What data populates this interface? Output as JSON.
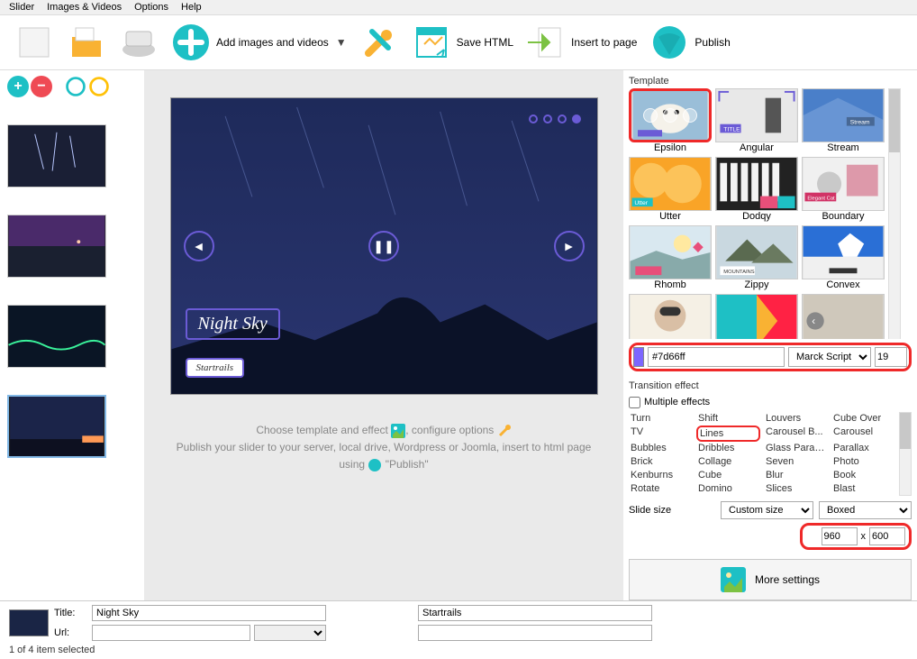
{
  "menu": {
    "slider": "Slider",
    "images": "Images & Videos",
    "options": "Options",
    "help": "Help"
  },
  "toolbar": {
    "addimages": "Add images and videos",
    "savehtml": "Save HTML",
    "insert": "Insert to page",
    "publish": "Publish"
  },
  "preview": {
    "title": "Night Sky",
    "subtitle": "Startrails"
  },
  "help": {
    "line1a": "Choose template and effect ",
    "line1b": ", configure options ",
    "line2": "Publish your slider to your server, local drive, Wordpress or Joomla, insert to html page",
    "line3a": "using ",
    "line3b": " \"Publish\""
  },
  "templates_label": "Template",
  "templates": [
    "Epsilon",
    "Angular",
    "Stream",
    "Utter",
    "Dodqy",
    "Boundary",
    "Rhomb",
    "Zippy",
    "Convex"
  ],
  "font": {
    "color": "#7d66ff",
    "name": "Marck Script",
    "size": "19"
  },
  "transition_label": "Transition effect",
  "multiple_label": "Multiple effects",
  "effects": {
    "c1": [
      "Turn",
      "TV",
      "Bubbles",
      "Brick",
      "Kenburns",
      "Rotate"
    ],
    "c2": [
      "Shift",
      "Lines",
      "Dribbles",
      "Collage",
      "Cube",
      "Domino"
    ],
    "c3": [
      "Louvers",
      "Carousel B...",
      "Glass Parall...",
      "Seven",
      "Blur",
      "Slices"
    ],
    "c4": [
      "Cube Over",
      "Carousel",
      "Parallax",
      "Photo",
      "Book",
      "Blast"
    ]
  },
  "slide_size_label": "Slide size",
  "size_mode": "Custom size",
  "box_mode": "Boxed",
  "width": "960",
  "height": "600",
  "more": "More settings",
  "meta": {
    "title_label": "Title:",
    "title": "Night Sky",
    "subtitle": "Startrails",
    "url_label": "Url:"
  },
  "status": "1 of 4 item selected"
}
